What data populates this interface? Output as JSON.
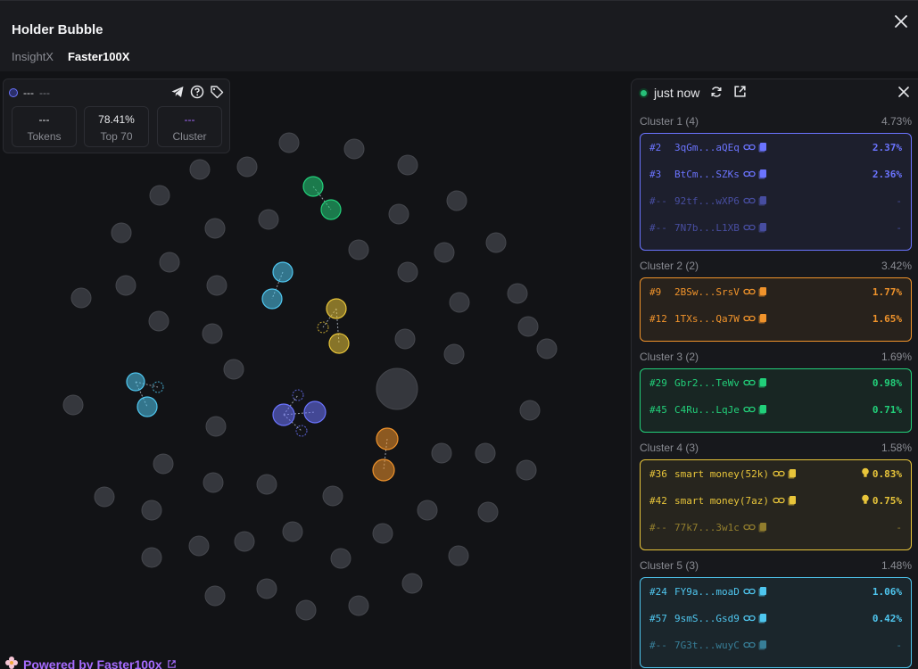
{
  "header": {
    "title": "Holder Bubble",
    "tabs": [
      {
        "label": "InsightX"
      },
      {
        "label": "Faster100X"
      }
    ]
  },
  "stats": {
    "head_value": "---",
    "head_sub": "---",
    "tokens_value": "---",
    "tokens_label": "Tokens",
    "top_value": "78.41%",
    "top_label": "Top 70",
    "cluster_value": "---",
    "cluster_label": "Cluster"
  },
  "powered": {
    "label": "Powered by Faster100x"
  },
  "side": {
    "status": "just now",
    "clusters": [
      {
        "title": "Cluster 1 (4)",
        "pct": "4.73%",
        "color": "#6b74ff",
        "rows": [
          {
            "rank": "#2",
            "addr": "3qGm...aQEq",
            "val": "2.37%"
          },
          {
            "rank": "#3",
            "addr": "BtCm...SZKs",
            "val": "2.36%"
          },
          {
            "rank": "#--",
            "addr": "92tf...wXP6",
            "val": "-"
          },
          {
            "rank": "#--",
            "addr": "7N7b...L1XB",
            "val": "-"
          }
        ]
      },
      {
        "title": "Cluster 2 (2)",
        "pct": "3.42%",
        "color": "#f0932b",
        "rows": [
          {
            "rank": "#9",
            "addr": "2BSw...SrsV",
            "val": "1.77%"
          },
          {
            "rank": "#12",
            "addr": "1TXs...Qa7W",
            "val": "1.65%"
          }
        ]
      },
      {
        "title": "Cluster 3 (2)",
        "pct": "1.69%",
        "color": "#22d07a",
        "rows": [
          {
            "rank": "#29",
            "addr": "Gbr2...TeWv",
            "val": "0.98%"
          },
          {
            "rank": "#45",
            "addr": "C4Ru...LqJe",
            "val": "0.71%"
          }
        ]
      },
      {
        "title": "Cluster 4 (3)",
        "pct": "1.58%",
        "color": "#e8c53a",
        "rows": [
          {
            "rank": "#36",
            "addr": "smart money(52k)",
            "val": "0.83%",
            "bulb": true
          },
          {
            "rank": "#42",
            "addr": "smart money(7az)",
            "val": "0.75%",
            "bulb": true
          },
          {
            "rank": "#--",
            "addr": "77k7...3w1c",
            "val": "-"
          }
        ]
      },
      {
        "title": "Cluster 5 (3)",
        "pct": "1.48%",
        "color": "#4fc6ef",
        "rows": [
          {
            "rank": "#24",
            "addr": "FY9a...moaD",
            "val": "1.06%"
          },
          {
            "rank": "#57",
            "addr": "9smS...Gsd9",
            "val": "0.42%"
          },
          {
            "rank": "#--",
            "addr": "7G3t...wuyC",
            "val": "-"
          }
        ]
      }
    ]
  },
  "colors": {
    "bubble_gray": "#35373d",
    "bubble_stroke": "#45474d",
    "accent_purple": "#a66bff"
  }
}
